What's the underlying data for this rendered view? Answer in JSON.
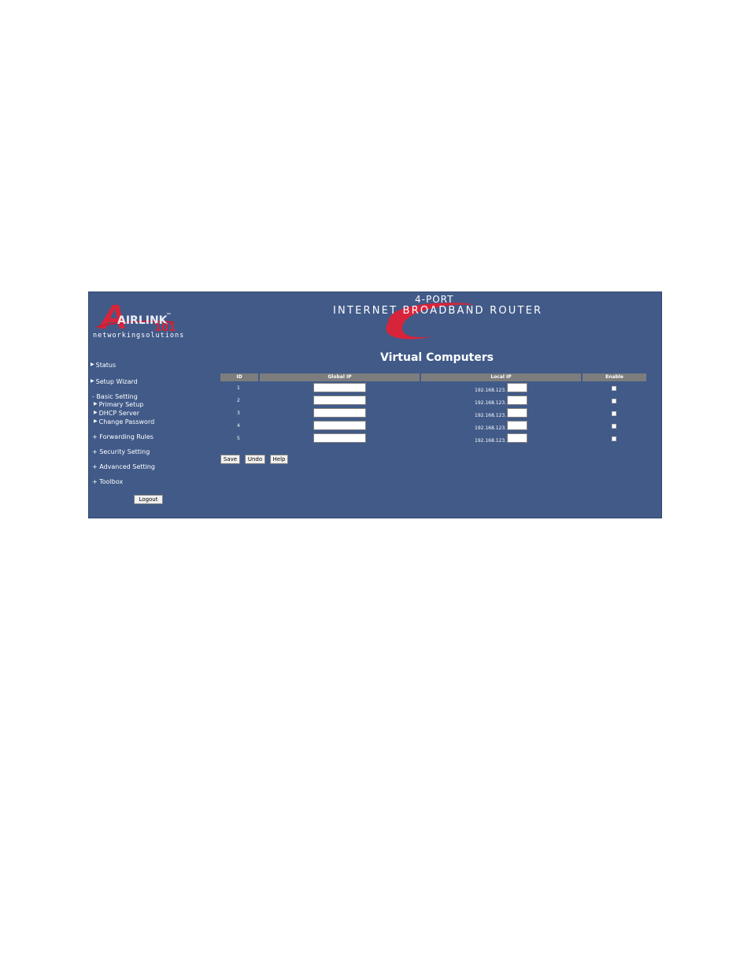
{
  "logo": {
    "letters": "AIRLINK",
    "number": "101",
    "tm": "™",
    "tagline": "networkingsolutions"
  },
  "banner": {
    "port": "4-PORT",
    "main": "INTERNET BROADBAND ROUTER"
  },
  "page_title": "Virtual Computers",
  "sidebar": {
    "status": "Status",
    "setup_wizard": "Setup Wizard",
    "basic_setting": "- Basic Setting",
    "primary_setup": "Primary Setup",
    "dhcp_server": "DHCP Server",
    "change_password": "Change Password",
    "forwarding_rules": "+ Forwarding Rules",
    "security_setting": "+ Security Setting",
    "advanced_setting": "+ Advanced Setting",
    "toolbox": "+ Toolbox",
    "logout": "Logout"
  },
  "table": {
    "headers": {
      "id": "ID",
      "global_ip": "Global IP",
      "local_ip": "Local IP",
      "enable": "Enable"
    },
    "ip_prefix": "192.168.123.",
    "rows": [
      {
        "id": "1"
      },
      {
        "id": "2"
      },
      {
        "id": "3"
      },
      {
        "id": "4"
      },
      {
        "id": "5"
      }
    ]
  },
  "buttons": {
    "save": "Save",
    "undo": "Undo",
    "help": "Help"
  },
  "colors": {
    "panel_bg": "#415a88",
    "header_bg": "#7d7d7d",
    "accent_red": "#d8243a"
  }
}
